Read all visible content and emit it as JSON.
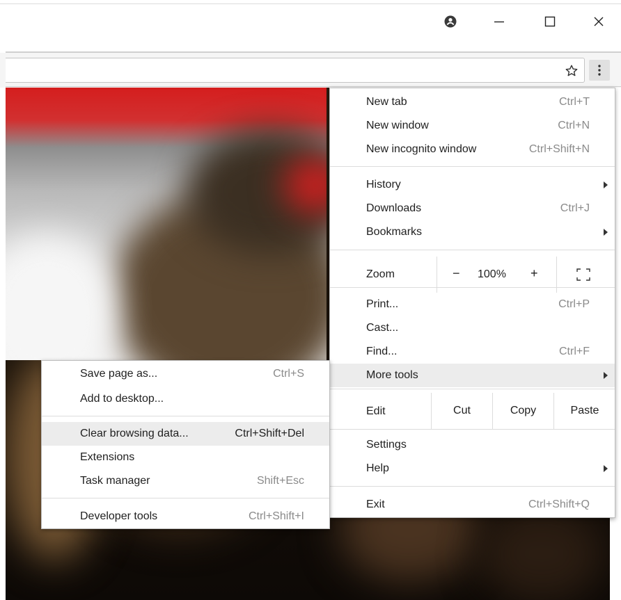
{
  "titlebar": {
    "icons": [
      "account-icon",
      "minimize-icon",
      "maximize-icon",
      "close-icon"
    ]
  },
  "toolbar": {
    "bookmark_icon": "star-icon",
    "menu_icon": "kebab-menu-icon"
  },
  "main_menu": {
    "items": [
      {
        "label": "New tab",
        "shortcut": "Ctrl+T"
      },
      {
        "label": "New window",
        "shortcut": "Ctrl+N"
      },
      {
        "label": "New incognito window",
        "shortcut": "Ctrl+Shift+N"
      },
      {
        "label": "History",
        "shortcut": ""
      },
      {
        "label": "Downloads",
        "shortcut": "Ctrl+J"
      },
      {
        "label": "Bookmarks",
        "shortcut": ""
      },
      {
        "label": "Print...",
        "shortcut": "Ctrl+P"
      },
      {
        "label": "Cast...",
        "shortcut": ""
      },
      {
        "label": "Find...",
        "shortcut": "Ctrl+F"
      },
      {
        "label": "More tools",
        "shortcut": ""
      },
      {
        "label": "Settings",
        "shortcut": ""
      },
      {
        "label": "Help",
        "shortcut": ""
      },
      {
        "label": "Exit",
        "shortcut": "Ctrl+Shift+Q"
      }
    ],
    "zoom": {
      "label": "Zoom",
      "minus": "−",
      "value": "100%",
      "plus": "+"
    },
    "edit": {
      "label": "Edit",
      "cut": "Cut",
      "copy": "Copy",
      "paste": "Paste"
    }
  },
  "more_tools_menu": {
    "items": [
      {
        "label": "Save page as...",
        "shortcut": "Ctrl+S"
      },
      {
        "label": "Add to desktop...",
        "shortcut": ""
      },
      {
        "label": "Clear browsing data...",
        "shortcut": "Ctrl+Shift+Del"
      },
      {
        "label": "Extensions",
        "shortcut": ""
      },
      {
        "label": "Task manager",
        "shortcut": "Shift+Esc"
      },
      {
        "label": "Developer tools",
        "shortcut": "Ctrl+Shift+I"
      }
    ]
  },
  "colors": {
    "highlight": "#ececec",
    "menu_bg": "#ffffff",
    "shortcut_text": "#8a8a8a"
  }
}
